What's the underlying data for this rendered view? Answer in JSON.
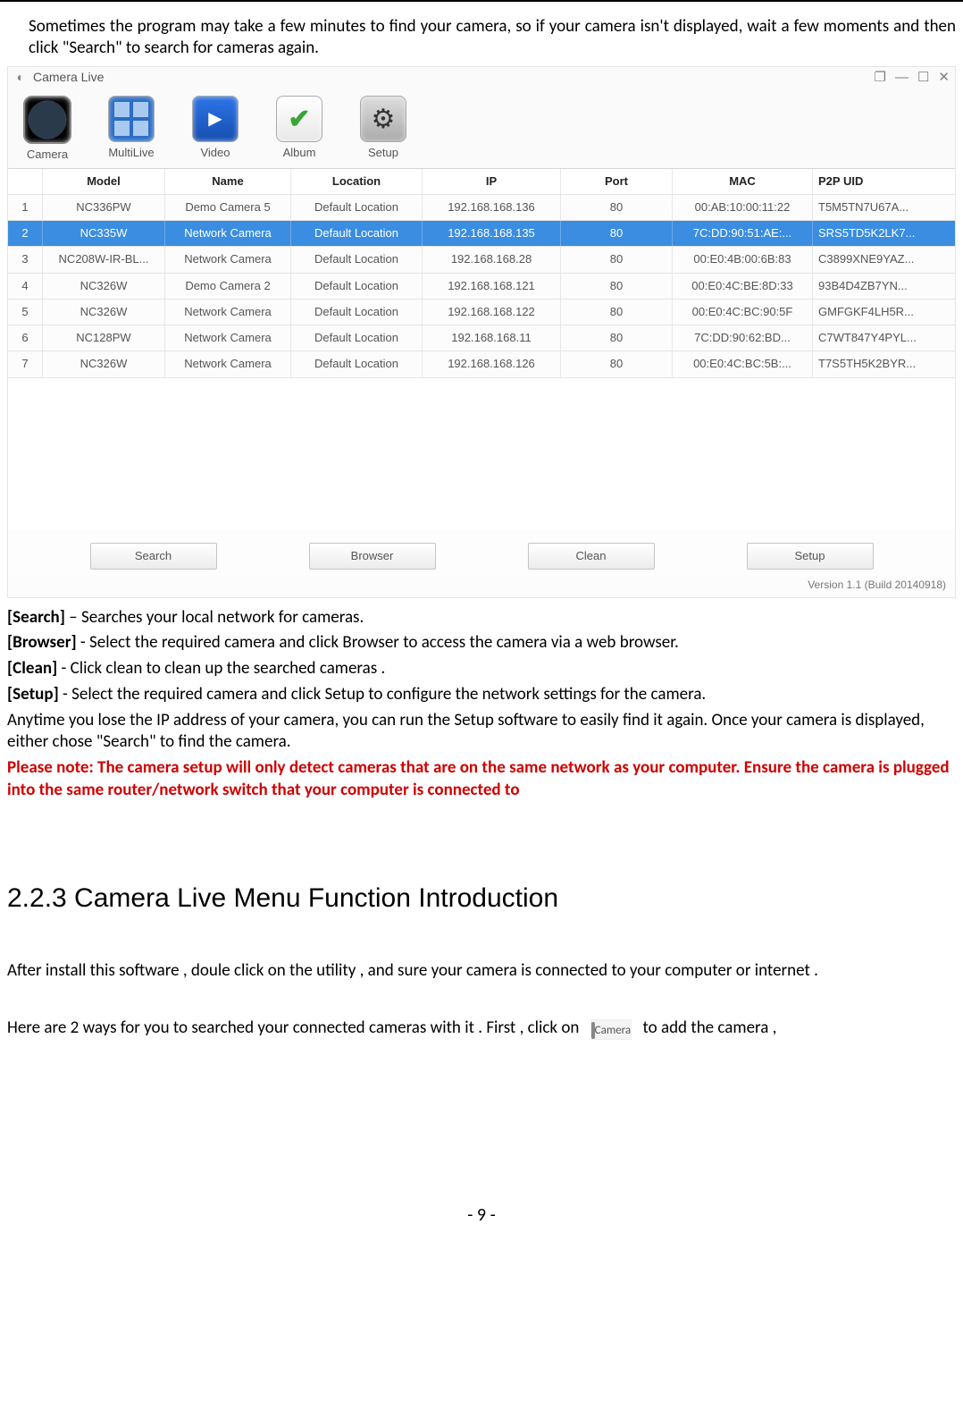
{
  "intro": "Sometimes the program may take a few minutes to find your camera, so if your camera isn't displayed, wait a few moments and then click \"Search\" to search for cameras again.",
  "app": {
    "title": "Camera Live",
    "toolbar": [
      {
        "label": "Camera",
        "icon": "cam"
      },
      {
        "label": "MultiLive",
        "icon": "multi"
      },
      {
        "label": "Video",
        "icon": "video"
      },
      {
        "label": "Album",
        "icon": "album"
      },
      {
        "label": "Setup",
        "icon": "setup"
      }
    ],
    "columns": [
      "",
      "Model",
      "Name",
      "Location",
      "IP",
      "Port",
      "MAC",
      "P2P UID"
    ],
    "rows": [
      {
        "idx": "1",
        "model": "NC336PW",
        "name": "Demo Camera 5",
        "loc": "Default Location",
        "ip": "192.168.168.136",
        "port": "80",
        "mac": "00:AB:10:00:11:22",
        "uid": "T5M5TN7U67A...",
        "sel": false
      },
      {
        "idx": "2",
        "model": "NC335W",
        "name": "Network Camera",
        "loc": "Default Location",
        "ip": "192.168.168.135",
        "port": "80",
        "mac": "7C:DD:90:51:AE:...",
        "uid": "SRS5TD5K2LK7...",
        "sel": true
      },
      {
        "idx": "3",
        "model": "NC208W-IR-BL...",
        "name": "Network Camera",
        "loc": "Default Location",
        "ip": "192.168.168.28",
        "port": "80",
        "mac": "00:E0:4B:00:6B:83",
        "uid": "C3899XNE9YAZ...",
        "sel": false
      },
      {
        "idx": "4",
        "model": "NC326W",
        "name": "Demo Camera 2",
        "loc": "Default Location",
        "ip": "192.168.168.121",
        "port": "80",
        "mac": "00:E0:4C:BE:8D:33",
        "uid": "93B4D4ZB7YN...",
        "sel": false
      },
      {
        "idx": "5",
        "model": "NC326W",
        "name": "Network Camera",
        "loc": "Default Location",
        "ip": "192.168.168.122",
        "port": "80",
        "mac": "00:E0:4C:BC:90:5F",
        "uid": "GMFGKF4LH5R...",
        "sel": false
      },
      {
        "idx": "6",
        "model": "NC128PW",
        "name": "Network Camera",
        "loc": "Default Location",
        "ip": "192.168.168.11",
        "port": "80",
        "mac": "7C:DD:90:62:BD...",
        "uid": "C7WT847Y4PYL...",
        "sel": false
      },
      {
        "idx": "7",
        "model": "NC326W",
        "name": "Network Camera",
        "loc": "Default Location",
        "ip": "192.168.168.126",
        "port": "80",
        "mac": "00:E0:4C:BC:5B:...",
        "uid": "T7S5TH5K2BYR...",
        "sel": false
      }
    ],
    "buttons": {
      "search": "Search",
      "browser": "Browser",
      "clean": "Clean",
      "setup": "Setup"
    },
    "version": "Version 1.1 (Build 20140918)"
  },
  "defs": {
    "search_head": "[Search]",
    "search_body": " – Searches your local network for cameras.",
    "browser_head": "[Browser]",
    "browser_body": " - Select the required camera and click Browser to access the camera via a web browser.",
    "clean_head": "[Clean]",
    "clean_body": " - Click clean to clean up the searched cameras .",
    "setup_head": "[Setup]",
    "setup_body": " - Select the required camera and click Setup to configure the network settings for the camera."
  },
  "anytime": "Anytime you lose the IP address of your camera, you can run the Setup software to easily find it again. Once your camera is displayed, either chose \"Search\" to find the camera.",
  "note": "Please note: The camera setup will only detect cameras that are on the same network as your computer. Ensure the camera is plugged into the same router/network switch that your computer is connected to",
  "section_title": "2.2.3 Camera Live Menu Function Introduction",
  "after_install": "After install this software , doule click on the utility , and sure your camera is connected to your computer or internet .",
  "ways_pre": "Here are 2 ways for you to searched your connected cameras with it . First , click on",
  "ways_post": "to add the camera ,",
  "inline_icon_label": "Camera",
  "page_number": "- 9 -"
}
